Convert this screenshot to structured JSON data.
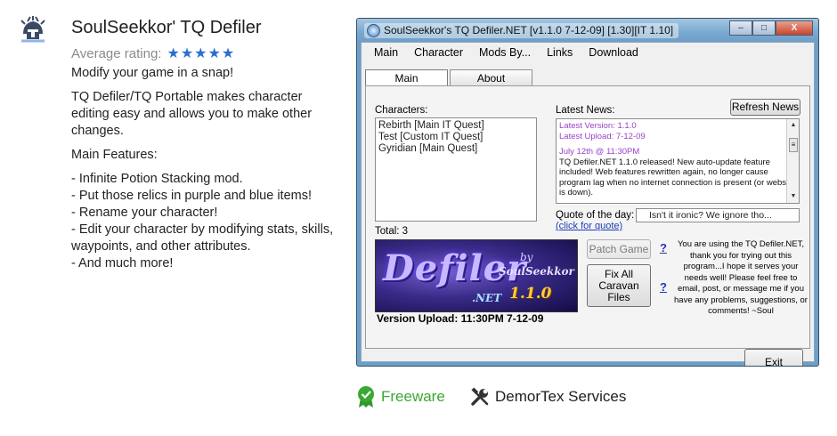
{
  "page": {
    "title": "SoulSeekkor' TQ Defiler",
    "rating_label": "Average rating:",
    "rating_stars": "★★★★★",
    "rating_value": 5,
    "tagline": "Modify your game in a snap!",
    "description": "TQ Defiler/TQ Portable makes character editing easy and allows you to make other changes.",
    "features_heading": "Main Features:",
    "features": [
      "- Infinite Potion Stacking mod.",
      "- Put those relics in purple and blue items!",
      "- Rename your character!",
      "- Edit your character by modifying stats, skills, waypoints, and other attributes.",
      "- And much more!"
    ],
    "license": "Freeware",
    "developer": "DemorTex Services",
    "colors": {
      "star": "#2b6fcf",
      "license": "#3aa832"
    }
  },
  "screenshot": {
    "window_title": "SoulSeekkor's TQ Defiler.NET [v1.1.0 7-12-09] [1.30][IT 1.10]",
    "menu": [
      "Main",
      "Character",
      "Mods By...",
      "Links",
      "Download"
    ],
    "tabs": [
      "Main",
      "About"
    ],
    "characters_label": "Characters:",
    "characters": [
      "Rebirth [Main IT Quest]",
      "Test [Custom IT Quest]",
      "Gyridian [Main Quest]"
    ],
    "total_label": "Total: 3",
    "latest_news_label": "Latest News:",
    "refresh_button": "Refresh News",
    "news": {
      "latest_version": "Latest Version: 1.1.0",
      "latest_upload": "Latest Upload: 7-12-09",
      "date": "July 12th @ 11:30PM",
      "body": "TQ Defiler.NET 1.1.0 released!  New auto-update feature included!  Web features rewritten again, no longer cause program lag when no internet connection is present (or website is down)."
    },
    "quote_label": "Quote of the day:",
    "quote_link": "(click for quote)",
    "quote_text": "Isn't it ironic? We ignore tho...",
    "patch_button": "Patch Game",
    "fix_button": "Fix All Caravan Files",
    "help_mark": "?",
    "info_text": "You are using the TQ Defiler.NET, thank you for trying out this program...I hope it serves your needs well!  Please feel free to email, post, or message me if you have any problems, suggestions, or comments!   ~Soul",
    "banner": {
      "title": "Defiler",
      "by": "by",
      "author": "SoulSeekkor",
      "net": ".NET",
      "version": "1.1.0"
    },
    "version_upload": "Version Upload: 11:30PM 7-12-09",
    "exit_button": "Exit",
    "window_buttons": {
      "minimize": "–",
      "maximize": "□",
      "close": "X"
    }
  }
}
